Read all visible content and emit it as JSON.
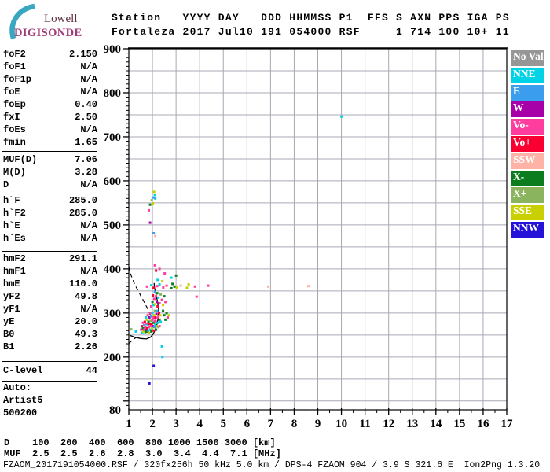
{
  "logo": {
    "top": "Lowell",
    "bottom": "DIGISONDE",
    "arc_color": "#3aa7c0",
    "top_color": "#5c2e3e",
    "bottom_color": "#a03a78"
  },
  "header": {
    "line1": "Station   YYYY DAY   DDD HHMMSS P1  FFS S AXN PPS IGA PS",
    "line2": "Fortaleza 2017 Jul10 191 054000 RSF     1 714 100 10+ 11"
  },
  "left_panel": {
    "groups": [
      {
        "rows": [
          [
            "foF2",
            "2.150"
          ],
          [
            "foF1",
            "N/A"
          ],
          [
            "foF1p",
            "N/A"
          ],
          [
            "foE",
            "N/A"
          ],
          [
            "foEp",
            "0.40"
          ],
          [
            "fxI",
            "2.50"
          ],
          [
            "foEs",
            "N/A"
          ],
          [
            "fmin",
            "1.65"
          ]
        ]
      },
      {
        "rows": [
          [
            "MUF(D)",
            "7.06"
          ],
          [
            "M(D)",
            "3.28"
          ],
          [
            "D",
            "N/A"
          ]
        ]
      },
      {
        "rows": [
          [
            "h`F",
            "285.0"
          ],
          [
            "h`F2",
            "285.0"
          ],
          [
            "h`E",
            "N/A"
          ],
          [
            "h`Es",
            "N/A"
          ]
        ]
      },
      {
        "rows": [
          [
            "hmF2",
            "291.1"
          ],
          [
            "hmF1",
            "N/A"
          ],
          [
            "hmE",
            "110.0"
          ],
          [
            "yF2",
            "49.8"
          ],
          [
            "yF1",
            "N/A"
          ],
          [
            "yE",
            "20.0"
          ],
          [
            "B0",
            "49.3"
          ],
          [
            "B1",
            "2.26"
          ]
        ]
      },
      {
        "rows": [
          [
            "C-level",
            "44"
          ]
        ]
      }
    ],
    "auto_lines": [
      "Auto:",
      "Artist5",
      "500200"
    ]
  },
  "bottom": {
    "d_row": "D    100  200  400  600  800 1000 1500 3000 [km]",
    "muf_row": "MUF  2.5  2.5  2.6  2.8  3.0  3.4  4.4  7.1 [MHz]"
  },
  "footer": {
    "text": "FZAOM_2017191054000.RSF / 320fx256h 50 kHz 5.0 km / DPS-4 FZAOM 904 / 3.9 S 321.6 E  Ion2Png 1.3.20"
  },
  "chart_data": {
    "type": "scatter",
    "title": "Fortaleza ionogram 2017 Jul10 191 054000",
    "xlabel": "",
    "ylabel": "",
    "x_range": [
      1,
      17
    ],
    "y_range": [
      80,
      900
    ],
    "x_ticks": [
      1,
      2,
      3,
      4,
      5,
      6,
      7,
      8,
      9,
      10,
      11,
      12,
      13,
      14,
      15,
      16,
      17
    ],
    "y_tick_values": [
      900,
      800,
      700,
      600,
      500,
      400,
      300,
      200,
      80
    ],
    "grid": {
      "on": true,
      "x_step": 1,
      "y_step": 50,
      "color": "#a9a9b6"
    },
    "legend_position": "right",
    "legend": [
      {
        "label": "No Val",
        "color": "#969696"
      },
      {
        "label": "NNE",
        "color": "#00d3e6"
      },
      {
        "label": "E",
        "color": "#3b9ded"
      },
      {
        "label": "W",
        "color": "#a800a8"
      },
      {
        "label": "Vo-",
        "color": "#ff3d9e"
      },
      {
        "label": "Vo+",
        "color": "#fa0032"
      },
      {
        "label": "SSW",
        "color": "#ffb3a7"
      },
      {
        "label": "X-",
        "color": "#0b7d1f"
      },
      {
        "label": "X+",
        "color": "#8ab45e"
      },
      {
        "label": "SSE",
        "color": "#c9cf00"
      },
      {
        "label": "NNW",
        "color": "#2412d9"
      }
    ],
    "solid_trace": [
      [
        1.05,
        249
      ],
      [
        1.25,
        245
      ],
      [
        1.5,
        242
      ],
      [
        1.75,
        241
      ],
      [
        1.92,
        245
      ],
      [
        2.03,
        252
      ],
      [
        2.12,
        262
      ],
      [
        2.2,
        276
      ],
      [
        2.25,
        292
      ],
      [
        2.26,
        308
      ],
      [
        2.22,
        325
      ],
      [
        2.15,
        342
      ],
      [
        2.09,
        356
      ],
      [
        2.07,
        368
      ]
    ],
    "dashed_traces": [
      [
        [
          1.0,
          405
        ],
        [
          1.1,
          385
        ],
        [
          1.25,
          365
        ],
        [
          1.45,
          345
        ],
        [
          1.65,
          325
        ],
        [
          1.82,
          307
        ],
        [
          1.93,
          292
        ],
        [
          1.98,
          283
        ]
      ],
      [
        [
          1.0,
          231
        ],
        [
          1.15,
          238
        ],
        [
          1.3,
          244
        ],
        [
          1.45,
          247
        ]
      ]
    ],
    "points": [
      [
        2.07,
        575,
        "SSE"
      ],
      [
        2.1,
        568,
        "NNE"
      ],
      [
        2.12,
        560,
        "NNE"
      ],
      [
        2.05,
        562,
        "E"
      ],
      [
        1.97,
        556,
        "X+"
      ],
      [
        1.9,
        546,
        "X-"
      ],
      [
        2.02,
        549,
        "SSE"
      ],
      [
        1.85,
        533,
        "Vo-"
      ],
      [
        1.9,
        505,
        "W"
      ],
      [
        2.05,
        481,
        "E"
      ],
      [
        2.12,
        475,
        "SSW"
      ],
      [
        10.0,
        746,
        "NNE"
      ],
      [
        2.4,
        224,
        "NNE"
      ],
      [
        2.42,
        200,
        "NNE"
      ],
      [
        2.05,
        180,
        "NNW"
      ],
      [
        1.87,
        140,
        "NNW"
      ],
      [
        2.1,
        408,
        "Vo-"
      ],
      [
        2.3,
        400,
        "Vo-"
      ],
      [
        2.52,
        390,
        "Vo-"
      ],
      [
        2.15,
        396,
        "Vo+"
      ],
      [
        2.8,
        380,
        "NNE"
      ],
      [
        3.0,
        385,
        "X-"
      ],
      [
        2.22,
        375,
        "NNE"
      ],
      [
        2.42,
        372,
        "SSE"
      ],
      [
        3.87,
        337,
        "Vo-"
      ],
      [
        1.77,
        360,
        "Vo-"
      ],
      [
        1.95,
        363,
        "NNE"
      ],
      [
        2.05,
        357,
        "Vo+"
      ],
      [
        2.2,
        361,
        "Vo-"
      ],
      [
        2.3,
        365,
        "NNE"
      ],
      [
        2.46,
        358,
        "Vo-"
      ],
      [
        2.6,
        362,
        "Vo-"
      ],
      [
        2.8,
        356,
        "X-"
      ],
      [
        2.85,
        366,
        "X-"
      ],
      [
        2.93,
        360,
        "X-"
      ],
      [
        3.03,
        358,
        "SSE"
      ],
      [
        3.2,
        362,
        "SSW"
      ],
      [
        3.46,
        357,
        "SSE"
      ],
      [
        3.53,
        365,
        "SSE"
      ],
      [
        3.8,
        360,
        "Vo-"
      ],
      [
        4.36,
        362,
        "Vo-"
      ],
      [
        6.9,
        360,
        "SSW"
      ],
      [
        8.6,
        361,
        "SSW"
      ],
      [
        1.95,
        315,
        "Vo-"
      ],
      [
        2.0,
        325,
        "X-"
      ],
      [
        2.02,
        340,
        "Vo+"
      ],
      [
        2.05,
        318,
        "NNE"
      ],
      [
        2.08,
        332,
        "Vo-"
      ],
      [
        2.1,
        348,
        "E"
      ],
      [
        2.12,
        320,
        "SSE"
      ],
      [
        2.15,
        338,
        "Vo-"
      ],
      [
        2.18,
        325,
        "W"
      ],
      [
        2.2,
        345,
        "X-"
      ],
      [
        2.22,
        315,
        "Vo+"
      ],
      [
        2.25,
        335,
        "NNE"
      ],
      [
        2.3,
        322,
        "Vo-"
      ],
      [
        2.35,
        342,
        "X+"
      ],
      [
        2.4,
        330,
        "Vo-"
      ],
      [
        2.45,
        318,
        "SSE"
      ],
      [
        2.5,
        338,
        "X-"
      ],
      [
        2.55,
        325,
        "Vo-"
      ],
      [
        1.1,
        263,
        "X+"
      ],
      [
        1.3,
        258,
        "NNE"
      ],
      [
        1.52,
        262,
        "Vo-"
      ],
      [
        1.55,
        270,
        "Vo+"
      ],
      [
        1.57,
        255,
        "NNE"
      ],
      [
        1.6,
        265,
        "X-"
      ],
      [
        1.6,
        278,
        "Vo-"
      ],
      [
        1.62,
        258,
        "SSE"
      ],
      [
        1.65,
        272,
        "E"
      ],
      [
        1.65,
        262,
        "Vo-"
      ],
      [
        1.68,
        280,
        "Vo+"
      ],
      [
        1.7,
        255,
        "X+"
      ],
      [
        1.7,
        268,
        "Vo-"
      ],
      [
        1.72,
        290,
        "NNE"
      ],
      [
        1.73,
        262,
        "W"
      ],
      [
        1.75,
        275,
        "Vo-"
      ],
      [
        1.75,
        258,
        "X-"
      ],
      [
        1.77,
        285,
        "SSE"
      ],
      [
        1.78,
        265,
        "Vo+"
      ],
      [
        1.8,
        272,
        "NNE"
      ],
      [
        1.8,
        295,
        "Vo-"
      ],
      [
        1.82,
        260,
        "E"
      ],
      [
        1.83,
        280,
        "X-"
      ],
      [
        1.85,
        268,
        "Vo-"
      ],
      [
        1.85,
        255,
        "SSE"
      ],
      [
        1.87,
        290,
        "W"
      ],
      [
        1.88,
        275,
        "Vo+"
      ],
      [
        1.9,
        262,
        "NNE"
      ],
      [
        1.9,
        300,
        "Vo-"
      ],
      [
        1.92,
        282,
        "X+"
      ],
      [
        1.93,
        270,
        "Vo-"
      ],
      [
        1.95,
        258,
        "X-"
      ],
      [
        1.95,
        292,
        "E"
      ],
      [
        1.97,
        275,
        "Vo+"
      ],
      [
        1.98,
        265,
        "SSE"
      ],
      [
        2.0,
        285,
        "Vo-"
      ],
      [
        2.0,
        300,
        "NNE"
      ],
      [
        2.02,
        270,
        "W"
      ],
      [
        2.03,
        290,
        "Vo-"
      ],
      [
        2.05,
        278,
        "X-"
      ],
      [
        2.05,
        260,
        "Vo+"
      ],
      [
        2.07,
        295,
        "SSE"
      ],
      [
        2.08,
        268,
        "E"
      ],
      [
        2.1,
        282,
        "Vo-"
      ],
      [
        2.1,
        305,
        "X+"
      ],
      [
        2.12,
        273,
        "NNE"
      ],
      [
        2.13,
        290,
        "Vo+"
      ],
      [
        2.15,
        280,
        "Vo-"
      ],
      [
        2.15,
        262,
        "X-"
      ],
      [
        2.17,
        298,
        "W"
      ],
      [
        2.18,
        270,
        "SSE"
      ],
      [
        2.2,
        288,
        "Vo-"
      ],
      [
        2.2,
        305,
        "E"
      ],
      [
        2.22,
        278,
        "NNE"
      ],
      [
        2.25,
        292,
        "Vo-"
      ],
      [
        2.25,
        268,
        "X+"
      ],
      [
        2.28,
        300,
        "Vo+"
      ],
      [
        2.3,
        285,
        "X-"
      ],
      [
        2.3,
        270,
        "Vo-"
      ],
      [
        2.33,
        295,
        "SSE"
      ],
      [
        2.35,
        280,
        "NNE"
      ],
      [
        2.5,
        295,
        "X-"
      ],
      [
        2.6,
        300,
        "X-"
      ],
      [
        2.55,
        285,
        "X-"
      ],
      [
        2.65,
        290,
        "Vo-"
      ],
      [
        2.45,
        305,
        "X-"
      ],
      [
        2.7,
        295,
        "SSE"
      ]
    ]
  }
}
